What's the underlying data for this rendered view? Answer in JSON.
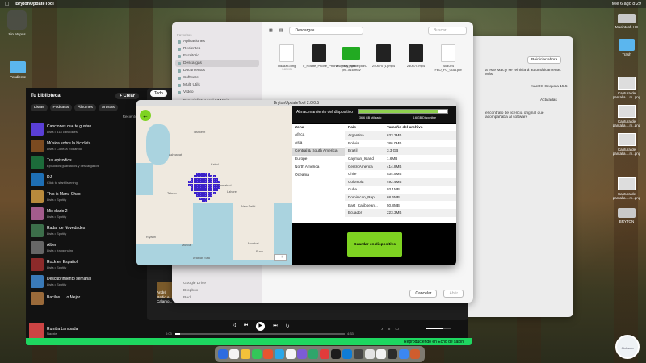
{
  "menubar": {
    "app": "BrytonUpdateTool",
    "datetime": "Mié 6 ago  8:29"
  },
  "desktop": {
    "left": [
      {
        "label": "Sin etapas"
      },
      {
        "label": "Pendiente"
      }
    ],
    "right": [
      {
        "label": "Macintosh HD"
      },
      {
        "label": "Trash"
      },
      {
        "label": "Captura de pantalla....m..png"
      },
      {
        "label": "Captura de pantalla....m..png"
      },
      {
        "label": "Captura de pantalla....m..png"
      },
      {
        "label": "Captura de pantalla....m..png"
      },
      {
        "label": "BRYTON"
      }
    ]
  },
  "spotify": {
    "library_title": "Tu biblioteca",
    "create_label": "+ Crear",
    "chips": [
      "Listas",
      "Pódcasts",
      "Álbumes",
      "Artistas"
    ],
    "recent_label": "Recientes",
    "todo_label": "Todo",
    "playlists": [
      {
        "title": "Canciones que te gustan",
        "subtitle": "Lista • 418 canciones",
        "color": "#5a3fd6"
      },
      {
        "title": "Música sobre la bicicleta",
        "subtitle": "Lista • Cofieza Rodando",
        "color": "#7b4a20"
      },
      {
        "title": "Tus episodios",
        "subtitle": "Episodios guardados y descargados",
        "color": "#1c6b3a"
      },
      {
        "title": "DJ",
        "subtitle": "Click to start listening",
        "color": "#1e6fb5"
      },
      {
        "title": "This is Manu Chao",
        "subtitle": "Lista • Spotify",
        "color": "#b88a3c"
      },
      {
        "title": "Mix diario 2",
        "subtitle": "Lista • Spotify",
        "color": "#a35c8c"
      },
      {
        "title": "Radar de Novedades",
        "subtitle": "Lista • Spotify",
        "color": "#3c6e4a"
      },
      {
        "title": "Albert",
        "subtitle": "Lista • frangenuine",
        "color": "#666666"
      },
      {
        "title": "Rock en Español",
        "subtitle": "Lista • Spotify",
        "color": "#8c2a2a"
      },
      {
        "title": "Descubrimiento semanal",
        "subtitle": "Lista • Spotify",
        "color": "#3a7ab8"
      },
      {
        "title": "Bacilos... Lo Mejor",
        "subtitle": "",
        "color": "#9a6a3a"
      }
    ],
    "card_title": "Radio A...",
    "card_sub": "Calamo...",
    "card_label": "André",
    "now_playing": {
      "title": "Rumba Lambada",
      "artist": "Naoxie"
    },
    "time_elapsed": "0:03",
    "time_total": "4:33",
    "progress": 0.03,
    "volume": 0.7,
    "connect_bar": "Reproduciendo en Echo de salón"
  },
  "finder": {
    "sections": [
      {
        "header": "Favoritos",
        "items": [
          "Aplicaciones",
          "Recientes",
          "Escritorio",
          "Descargas",
          "Documentos",
          "Software",
          "Multi Utils",
          "Vídeo"
        ]
      },
      {
        "header": "",
        "items": [
          "EspecialistaAcool 67 Minis"
        ]
      }
    ],
    "lower_items": [
      "Google Drive",
      "Dropbox",
      "Red",
      "BRYTON"
    ],
    "selected": "Descargas",
    "path": "Descargas",
    "search_placeholder": "Buscar",
    "files": [
      {
        "name": "Indaliz3.dmg",
        "size": "342 KB",
        "kind": "doc"
      },
      {
        "name": "0_Rotate_Phone_Phone..._300.mp4",
        "size": "",
        "kind": "dark"
      },
      {
        "name": "vectezcy_rotate-pion-ph...816.mov",
        "size": "",
        "kind": "green"
      },
      {
        "name": "240570 (1).mp4",
        "size": "",
        "kind": "dark"
      },
      {
        "name": "240570.mp4",
        "size": "",
        "kind": "dark"
      },
      {
        "name": "i404024 FBO_FC_Guia.pdf",
        "size": "",
        "kind": "doc"
      }
    ],
    "cancel_label": "Cancelar",
    "open_label": "Abrir"
  },
  "settings": {
    "reboot_label": "Reiniciar ahora",
    "os_label": "macOS Sequoia 15.5",
    "enabled_label": "Activadas",
    "warning_text": "a este Mac y se reiniciará automáticamente. Más",
    "legal_text": "el contrato de licencia original que acompañaba al software"
  },
  "bryton": {
    "title": "BrytonUpdateTool 2.0.0.5",
    "storage_label": "Almacenamiento del dispositivo",
    "storage_used": "36.6 GB utilizado",
    "storage_free": "4.6 GB Disponible",
    "storage_fill": 0.89,
    "zone_header": "Zona",
    "zones": [
      "Africa",
      "Asia",
      "Central & South America",
      "Europe",
      "North America",
      "Oceania"
    ],
    "selected_zone": "Central & South America",
    "country_header": "País",
    "size_header": "Tamaño del archivo",
    "countries": [
      {
        "name": "Argentina",
        "size": "633.3MB"
      },
      {
        "name": "Bolivia",
        "size": "386.0MB"
      },
      {
        "name": "Brazil",
        "size": "3.3 GB"
      },
      {
        "name": "Cayman_Island",
        "size": "1.6MB"
      },
      {
        "name": "CentroAmerica",
        "size": "414.8MB"
      },
      {
        "name": "Chile",
        "size": "534.5MB"
      },
      {
        "name": "Colombia",
        "size": "492.4MB"
      },
      {
        "name": "Cuba",
        "size": "93.1MB"
      },
      {
        "name": "Dominican_Rep...",
        "size": "68.6MB"
      },
      {
        "name": "East_Caribbean...",
        "size": "50.8MB"
      },
      {
        "name": "Ecuador",
        "size": "223.3MB"
      }
    ],
    "save_label": "Guardar en dispositivo",
    "map_labels": [
      {
        "text": "Tehran"
      },
      {
        "text": "Kabul"
      },
      {
        "text": "Islamabad"
      },
      {
        "text": "Lahore"
      },
      {
        "text": "New Delhi"
      },
      {
        "text": "Riyadh"
      },
      {
        "text": "Muscat"
      },
      {
        "text": "Mumbai"
      },
      {
        "text": "Pune"
      },
      {
        "text": "Arabian Sea"
      },
      {
        "text": "Ashgabat"
      },
      {
        "text": "Tashkent"
      }
    ]
  },
  "dock_colors": [
    "#2d6cdf",
    "#f4f4f4",
    "#f3c13a",
    "#34c759",
    "#e8542f",
    "#2aa7e8",
    "#f5f5f5",
    "#7c5cd6",
    "#2fa56b",
    "#e23b3b",
    "#1c1c1c",
    "#0f7cd6",
    "#444444",
    "#e3e3e3",
    "#f2f2f2",
    "#2b2b2b",
    "#3b87f0",
    "#cf5d2e"
  ],
  "watermark": "Ciclismo"
}
